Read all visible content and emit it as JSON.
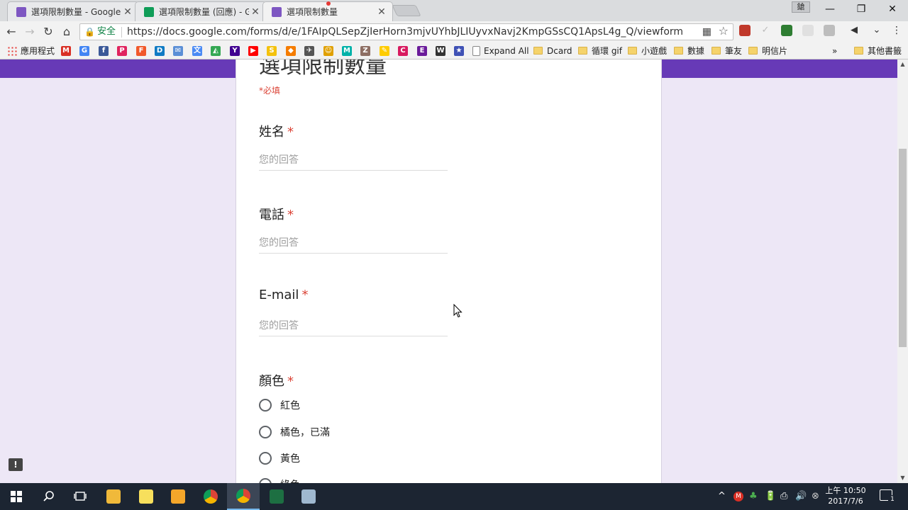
{
  "browser": {
    "tabs": [
      {
        "title": "選項限制數量 - Google 表",
        "favicon_color": "#7e57c2"
      },
      {
        "title": "選項限制數量 (回應) - Go",
        "favicon_color": "#0f9d58"
      },
      {
        "title": "選項限制數量",
        "favicon_color": "#7e57c2"
      }
    ],
    "profile_label": "鎗",
    "window_controls": {
      "minimize": "—",
      "restore": "❐",
      "close": "✕"
    },
    "nav": {
      "back": "←",
      "forward": "→",
      "reload": "↻",
      "home": "⌂"
    },
    "omnibox": {
      "lock": "🔒",
      "security_label": "安全",
      "url": "https://docs.google.com/forms/d/e/1FAIpQLSepZjIerHorn3mjvUYhbJLIUyvxNavj2KmpGSsCQ1ApsL4g_Q/viewform",
      "qr_icon": "▦",
      "star_icon": "☆"
    }
  },
  "bookmarks": {
    "apps_label": "應用程式",
    "items": [
      {
        "label": "M",
        "color": "#d93025"
      },
      {
        "label": "G",
        "color": "#4285f4"
      },
      {
        "label": "f",
        "color": "#3b5998"
      },
      {
        "label": "P",
        "color": "#e0245e"
      },
      {
        "label": "F",
        "color": "#f1592a"
      },
      {
        "label": "D",
        "color": "#0f7bc4"
      },
      {
        "label": "✉",
        "color": "#5b8fd6"
      },
      {
        "label": "文",
        "color": "#4a8af4"
      },
      {
        "label": "◭",
        "color": "#34a853"
      },
      {
        "label": "Y",
        "color": "#400090"
      },
      {
        "label": "▶",
        "color": "#ff0000"
      },
      {
        "label": "S",
        "color": "#f4c20d"
      },
      {
        "label": "◆",
        "color": "#f57c00"
      },
      {
        "label": "✈",
        "color": "#555555"
      },
      {
        "label": "☺",
        "color": "#e0a000"
      },
      {
        "label": "M",
        "color": "#00b2a9"
      },
      {
        "label": "Z",
        "color": "#8d6e63"
      },
      {
        "label": "✎",
        "color": "#ffcc00"
      },
      {
        "label": "C",
        "color": "#d81b60"
      },
      {
        "label": "E",
        "color": "#6a1b9a"
      },
      {
        "label": "W",
        "color": "#333333"
      },
      {
        "label": "★",
        "color": "#3f51b5"
      }
    ],
    "expand_all": "Expand All",
    "folders": [
      "Dcard",
      "循環 gif",
      "小遊戲",
      "數據",
      "筆友",
      "明信片"
    ],
    "overflow": "»",
    "other_bookmarks": "其他書籤"
  },
  "form": {
    "title": "選項限制數量",
    "required_note": "*必填",
    "questions": [
      {
        "title": "姓名",
        "required_mark": "*",
        "placeholder": "您的回答"
      },
      {
        "title": "電話",
        "required_mark": "*",
        "placeholder": "您的回答"
      },
      {
        "title": "E-mail",
        "required_mark": "*",
        "placeholder": "您的回答"
      }
    ],
    "choice_question": {
      "title": "顏色",
      "required_mark": "*",
      "options": [
        "紅色",
        "橘色，已滿",
        "黃色",
        "綠色"
      ]
    },
    "report_icon": "!"
  },
  "taskbar": {
    "clock_time": "上午 10:50",
    "clock_date": "2017/7/6",
    "notification_count": "1",
    "tray_icons": [
      "^",
      "M",
      "♣",
      "🔋",
      "⎙",
      "🔊",
      "⊗"
    ]
  },
  "colors": {
    "form_accent": "#673ab7",
    "form_background": "#ede7f6",
    "required": "#db4437",
    "taskbar": "#1c2532"
  }
}
